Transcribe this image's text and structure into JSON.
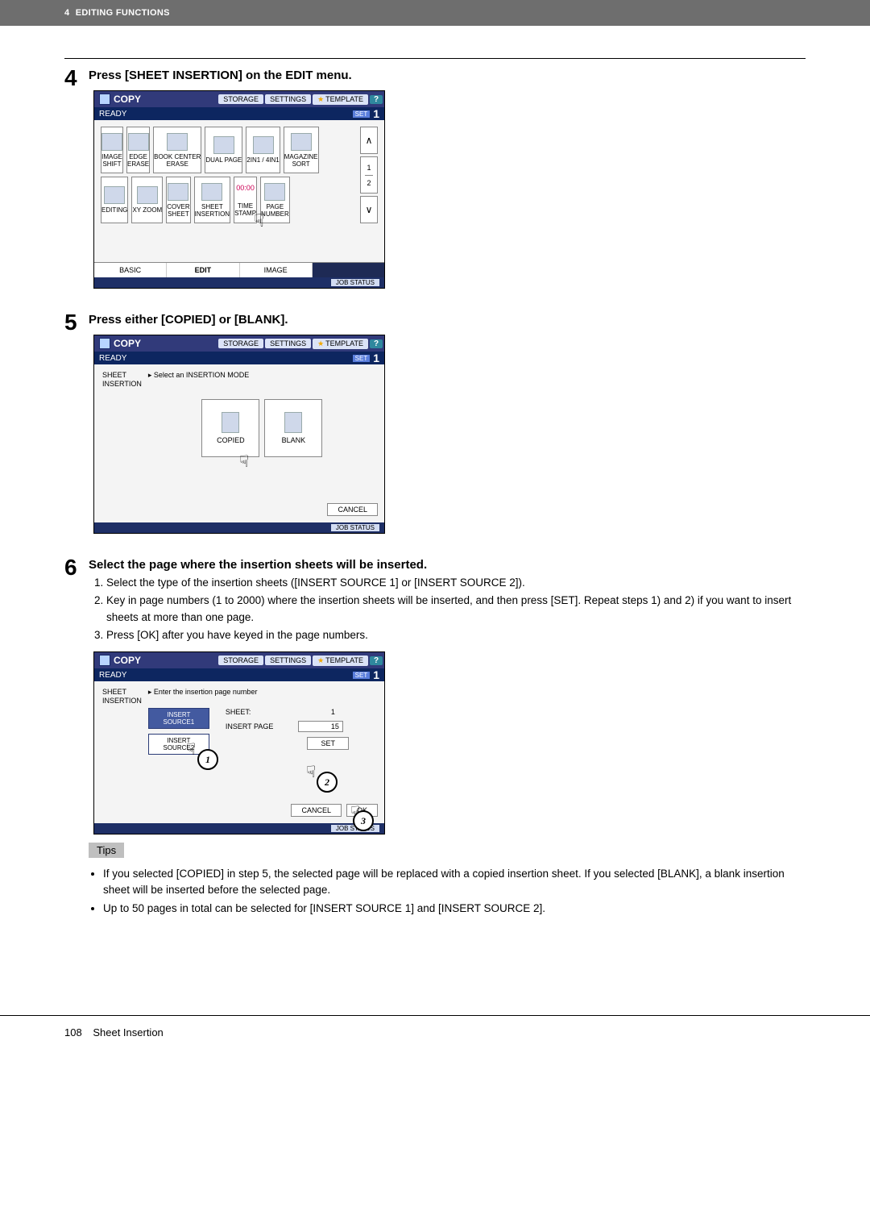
{
  "topbar": {
    "section_num": "4",
    "section_title": "EDITING FUNCTIONS"
  },
  "steps": {
    "s4": {
      "num": "4",
      "heading": "Press [SHEET INSERTION] on the EDIT menu."
    },
    "s5": {
      "num": "5",
      "heading": "Press either [COPIED] or [BLANK]."
    },
    "s6": {
      "num": "6",
      "heading": "Select the page where the insertion sheets will be inserted.",
      "items": [
        "Select the type of the insertion sheets ([INSERT SOURCE 1] or [INSERT SOURCE 2]).",
        "Key in page numbers (1 to 2000) where the insertion sheets will be inserted, and then press [SET]. Repeat steps 1) and 2) if you want to insert sheets at more than one page.",
        "Press [OK] after you have keyed in the page numbers."
      ]
    }
  },
  "tips": {
    "label": "Tips",
    "items": [
      "If you selected [COPIED] in step 5, the selected page will be replaced with a copied insertion sheet. If you selected [BLANK], a blank insertion sheet will be inserted before the selected page.",
      "Up to 50 pages in total can be selected for [INSERT SOURCE 1] and [INSERT SOURCE 2]."
    ]
  },
  "device_common": {
    "title": "COPY",
    "storage": "STORAGE",
    "settings": "SETTINGS",
    "template": "TEMPLATE",
    "help": "?",
    "ready": "READY",
    "set": "SET",
    "one": "1",
    "job_status": "JOB STATUS"
  },
  "device4": {
    "cells": [
      [
        "IMAGE\nSHIFT",
        "EDGE\nERASE",
        "BOOK CENTER\nERASE",
        "DUAL PAGE",
        "2IN1 / 4IN1",
        "MAGAZINE\nSORT"
      ],
      [
        "EDITING",
        "XY ZOOM",
        "COVER\nSHEET",
        "SHEET\nINSERTION",
        "TIME\nSTAMP",
        "PAGE\nNUMBER"
      ]
    ],
    "nav": {
      "up": "∧",
      "down": "∨",
      "p1": "1",
      "p2": "2"
    },
    "tabs": [
      "BASIC",
      "EDIT",
      "IMAGE"
    ],
    "time": "00:00"
  },
  "device5": {
    "left_label": "SHEET\nINSERTION",
    "prompt": "▸ Select an INSERTION MODE",
    "copied": "COPIED",
    "blank": "BLANK",
    "cancel": "CANCEL"
  },
  "device6": {
    "left_label": "SHEET\nINSERTION",
    "prompt": "▸ Enter the insertion page number",
    "src1": "INSERT\nSOURCE1",
    "src2": "INSERT\nSOURCE2",
    "sheet_label": "SHEET:",
    "sheet_val": "1",
    "page_label": "INSERT PAGE",
    "page_val": "15",
    "set": "SET",
    "cancel": "CANCEL",
    "ok": "OK",
    "callouts": {
      "c1": "1",
      "c2": "2",
      "c3": "3"
    }
  },
  "footer": {
    "page": "108",
    "title": "Sheet Insertion"
  }
}
